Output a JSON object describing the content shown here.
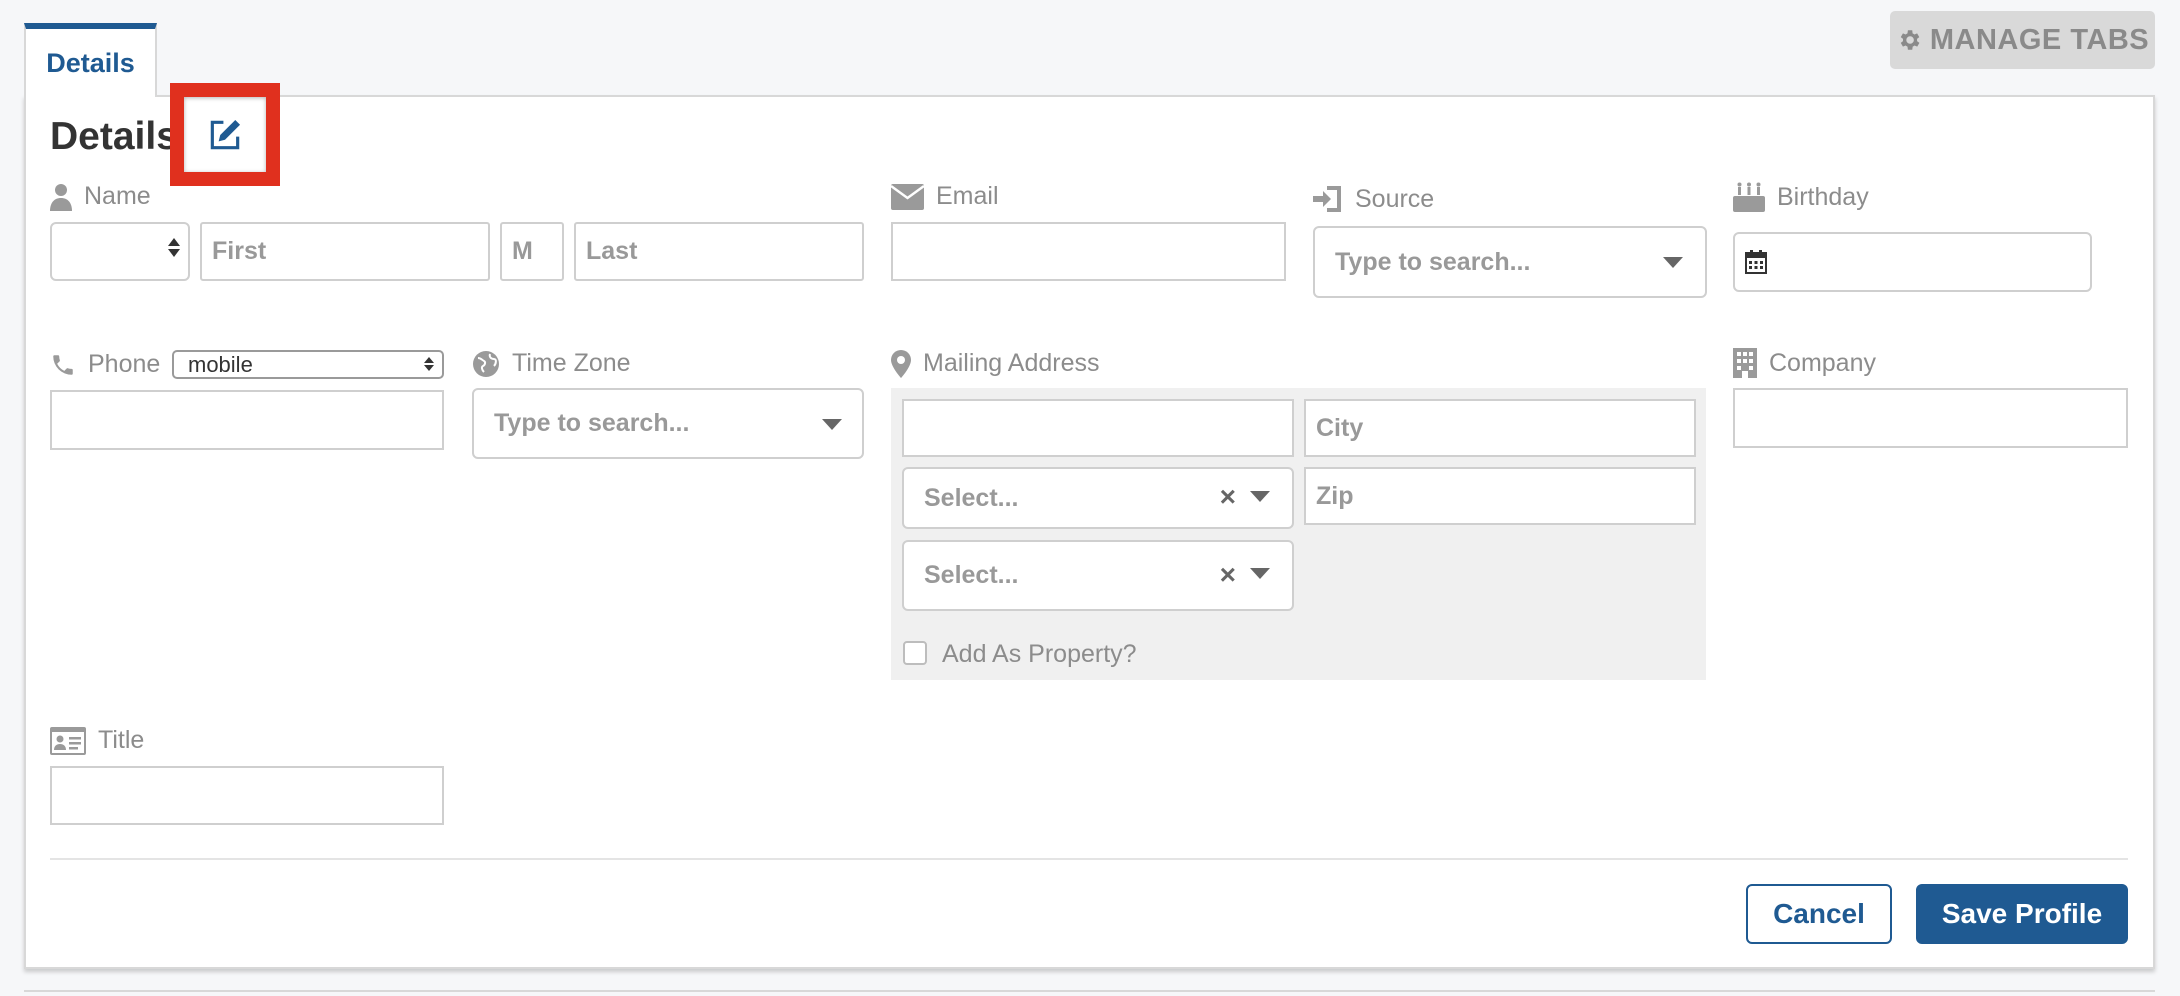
{
  "tabs": [
    {
      "label": "Details",
      "active": true
    }
  ],
  "toolbar": {
    "manage_tabs_label": "MANAGE TABS"
  },
  "section": {
    "title": "Details"
  },
  "fields": {
    "name": {
      "label": "Name",
      "prefix_value": "",
      "first_placeholder": "First",
      "middle_placeholder": "M",
      "last_placeholder": "Last"
    },
    "email": {
      "label": "Email",
      "value": ""
    },
    "source": {
      "label": "Source",
      "placeholder": "Type to search..."
    },
    "birthday": {
      "label": "Birthday",
      "value": ""
    },
    "phone": {
      "label": "Phone",
      "type_selected": "mobile",
      "value": ""
    },
    "timezone": {
      "label": "Time Zone",
      "placeholder": "Type to search..."
    },
    "mailing_address": {
      "label": "Mailing Address",
      "street_value": "",
      "city_placeholder": "City",
      "state_placeholder": "Select...",
      "zip_placeholder": "Zip",
      "country_placeholder": "Select...",
      "add_as_property_label": "Add As Property?",
      "add_as_property_checked": false
    },
    "company": {
      "label": "Company",
      "value": ""
    },
    "title": {
      "label": "Title",
      "value": ""
    }
  },
  "actions": {
    "cancel_label": "Cancel",
    "save_label": "Save Profile"
  },
  "colors": {
    "accent": "#1f5a92",
    "highlight": "#e0301e",
    "address_bg": "#f0f0f0"
  }
}
